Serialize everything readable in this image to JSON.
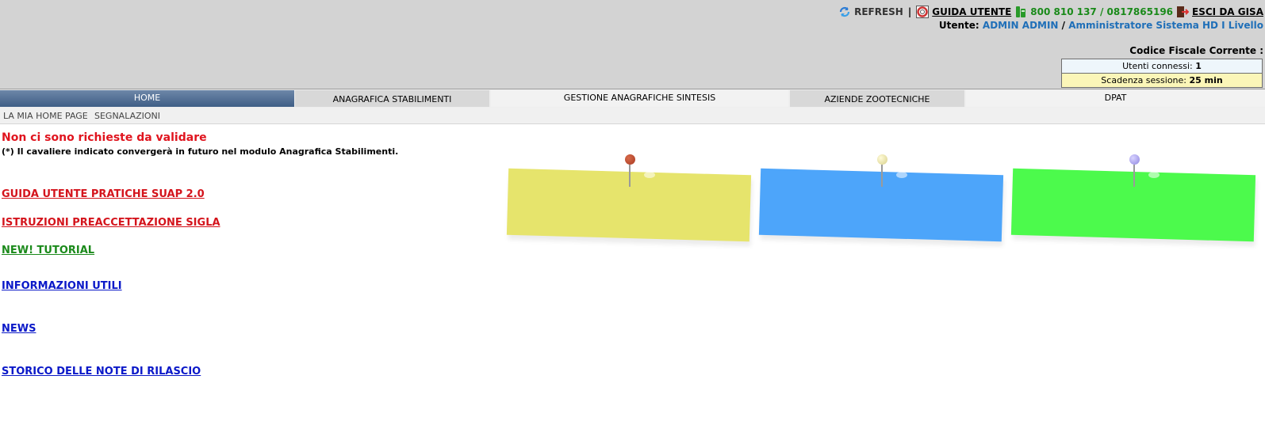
{
  "header": {
    "refresh_label": "REFRESH",
    "separator": "|",
    "guida_label": "GUIDA UTENTE",
    "phone_label": "800 810 137 / 0817865196",
    "esci_label": "ESCI DA GISA",
    "user_prefix": "Utente:",
    "user_name": "ADMIN ADMIN",
    "user_slash": "/",
    "user_role": "Amministratore Sistema HD I Livello",
    "codice_fiscale_label": "Codice Fiscale Corrente :",
    "utenti_label": "Utenti connessi:",
    "utenti_value": "1",
    "scadenza_label": "Scadenza sessione:",
    "scadenza_value": "25 min",
    "icons": [
      "refresh-icon",
      "lifebuoy-icon",
      "phone-icon",
      "exit-icon"
    ]
  },
  "menu": {
    "tabs": [
      "HOME",
      "ANAGRAFICA STABILIMENTI",
      "GESTIONE ANAGRAFICHE SINTESIS",
      "AZIENDE ZOOTECNICHE",
      "DPAT"
    ],
    "active": "HOME"
  },
  "submenu": {
    "items": [
      "LA MIA HOME PAGE",
      "SEGNALAZIONI"
    ]
  },
  "main": {
    "message": "Non ci sono richieste da validare",
    "note": "(*) Il cavaliere indicato convergerà in futuro nel modulo Anagrafica Stabilimenti.",
    "links": [
      "GUIDA UTENTE PRATICHE SUAP 2.0",
      "ISTRUZIONI PREACCETTAZIONE SIGLA",
      "NEW! TUTORIAL",
      "INFORMAZIONI UTILI",
      "NEWS",
      "STORICO DELLE NOTE DI RILASCIO"
    ]
  },
  "notes": [
    {
      "color": "#e6e46c",
      "pin_color": "#a83a22"
    },
    {
      "color": "#4da5fa",
      "pin_color": "#ece7a8"
    },
    {
      "color": "#4cfa4c",
      "pin_color": "#a9a0ee"
    }
  ],
  "colors": {
    "header_bg": "#d3d3d3",
    "home_tab": "#4f6c93",
    "message_red": "#e0141e",
    "link_red": "#d4141c",
    "link_green": "#1b8a1b",
    "link_blue": "#0a18c8"
  }
}
